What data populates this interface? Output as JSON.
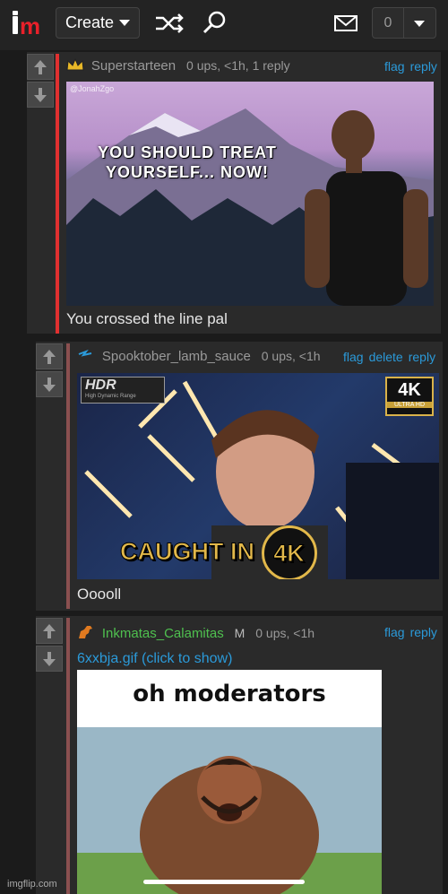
{
  "header": {
    "create_label": "Create",
    "notification_count": "0"
  },
  "comments": [
    {
      "username": "Superstarteen",
      "meta": "0 ups, <1h, 1 reply",
      "actions": [
        "flag",
        "reply"
      ],
      "image_watermark": "@JonahZgo",
      "image_caption": "YOU SHOULD TREAT YOURSELF... NOW!",
      "text": "You crossed the line pal"
    },
    {
      "username": "Spooktober_lamb_sauce",
      "meta": "0 ups, <1h",
      "actions": [
        "flag",
        "delete",
        "reply"
      ],
      "image_badge_left": "HDR",
      "image_badge_left_sub": "High Dynamic Range",
      "image_badge_right": "4K",
      "image_badge_right_sub": "ULTRA HD",
      "image_caption": "CAUGHT IN",
      "image_caption_circle": "4K",
      "text": "Ooooll"
    },
    {
      "username": "Inkmatas_Calamitas",
      "user_flag": "M",
      "meta": "0 ups, <1h",
      "actions": [
        "flag",
        "reply"
      ],
      "gif_link": "6xxbja.gif (click to show)",
      "image_caption": "oh moderators"
    }
  ],
  "footer": {
    "watermark": "imgflip.com"
  },
  "colors": {
    "link": "#2b9ad9",
    "brand_red": "#e8202a",
    "bar_red": "#e03030",
    "bar_muted": "#8a5050",
    "username_green": "#4fc04f"
  }
}
